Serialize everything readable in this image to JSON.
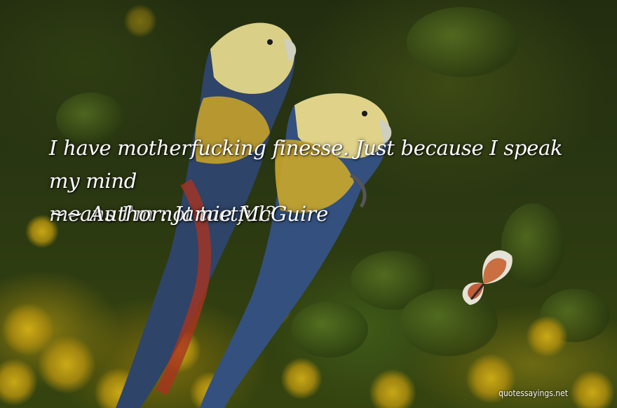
{
  "quote": {
    "line1": "I have motherfucking finesse. Just because I speak my mind",
    "line2": "means I'm not tactful?"
  },
  "author": {
    "prefix": "~~",
    "label": "Author:",
    "name": "Jamie McGuire"
  },
  "watermark": "quotessayings.net",
  "background": {
    "description_icons": [
      "parrot-icon",
      "butterfly-icon",
      "wattle-flower-icon"
    ],
    "palette": {
      "foliage_dark": "#222d0f",
      "foliage_mid": "#3d4a14",
      "wattle_yellow": "#c9a413",
      "parrot_yellow": "#d8c46a",
      "parrot_blue": "#2f4a7a",
      "parrot_red": "#a8331f"
    }
  }
}
